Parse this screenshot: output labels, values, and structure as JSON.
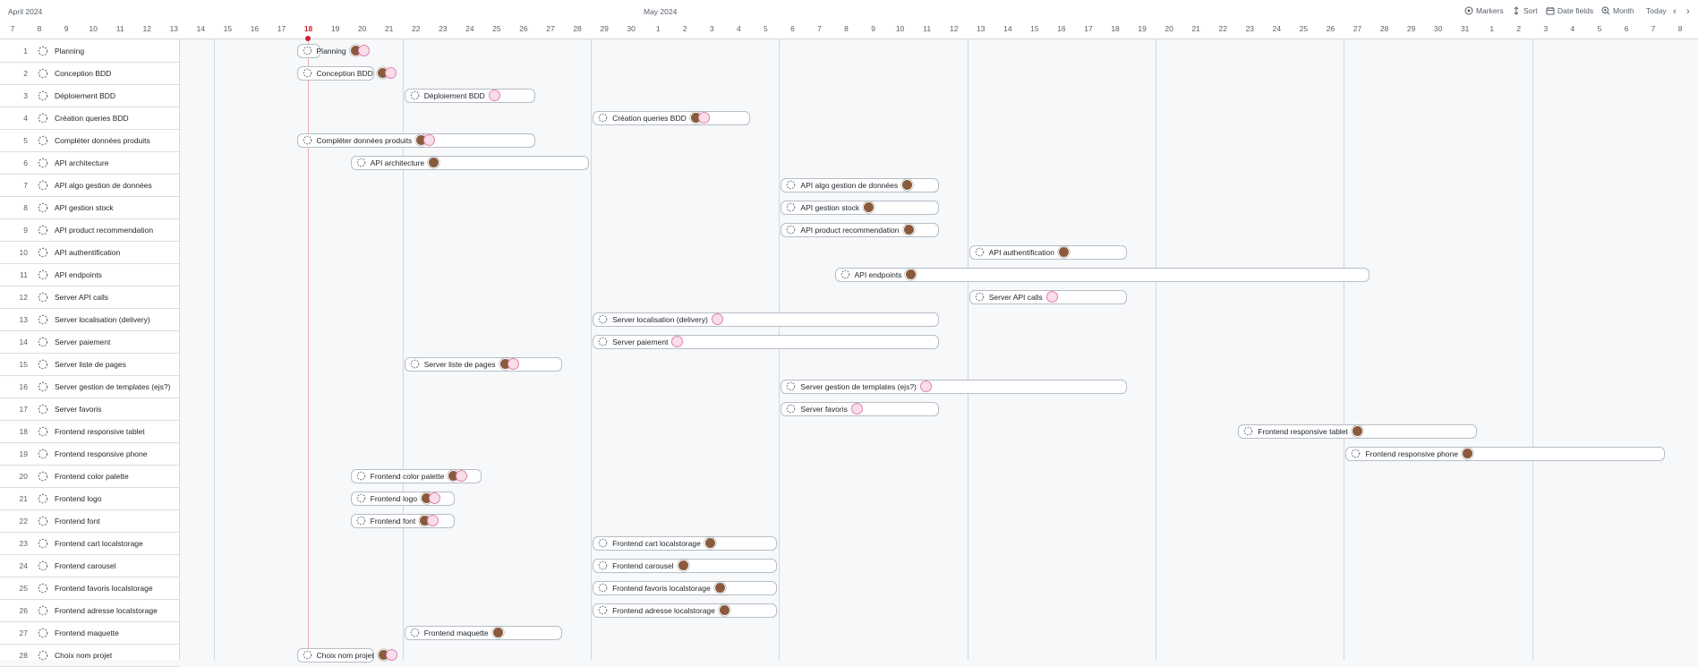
{
  "header": {
    "month_april": "April 2024",
    "month_may": "May 2024",
    "days": [
      "7",
      "8",
      "9",
      "10",
      "11",
      "12",
      "13",
      "14",
      "15",
      "16",
      "17",
      "18",
      "19",
      "20",
      "21",
      "22",
      "23",
      "24",
      "25",
      "26",
      "27",
      "28",
      "29",
      "30",
      "1",
      "2",
      "3",
      "4",
      "5",
      "6",
      "7",
      "8",
      "9",
      "10",
      "11",
      "12",
      "13",
      "14",
      "15",
      "16",
      "17",
      "18",
      "19",
      "20",
      "21",
      "22",
      "23",
      "24",
      "25",
      "26",
      "27",
      "28",
      "29",
      "30",
      "31",
      "1",
      "2",
      "3",
      "4",
      "5",
      "6",
      "7",
      "8"
    ],
    "today_day": "18",
    "toolbar": {
      "markers": "Markers",
      "sort": "Sort",
      "date_fields": "Date fields",
      "month": "Month",
      "today": "Today"
    }
  },
  "rows": [
    {
      "num": "1",
      "title": "Planning",
      "bar": {
        "label": "Planning",
        "start": 11,
        "end": 11,
        "avatar": "both"
      }
    },
    {
      "num": "2",
      "title": "Conception BDD",
      "bar": {
        "label": "Conception BDD",
        "start": 11,
        "end": 13,
        "avatar": "both"
      }
    },
    {
      "num": "3",
      "title": "Déploiement BDD",
      "bar": {
        "label": "Déploiement BDD",
        "start": 15,
        "end": 19,
        "avatar": "pink"
      }
    },
    {
      "num": "4",
      "title": "Création queries BDD",
      "bar": {
        "label": "Création queries BDD",
        "start": 22,
        "end": 27,
        "avatar": "both"
      }
    },
    {
      "num": "5",
      "title": "Compléter données produits",
      "bar": {
        "label": "Compléter données produits",
        "start": 11,
        "end": 19,
        "avatar": "both"
      }
    },
    {
      "num": "6",
      "title": "API architecture",
      "bar": {
        "label": "API architecture",
        "start": 13,
        "end": 21,
        "avatar": "brown"
      }
    },
    {
      "num": "7",
      "title": "API algo gestion de données",
      "bar": {
        "label": "API algo gestion de données",
        "start": 29,
        "end": 34,
        "avatar": "brown"
      }
    },
    {
      "num": "8",
      "title": "API gestion stock",
      "bar": {
        "label": "API gestion stock",
        "start": 29,
        "end": 34,
        "avatar": "brown"
      }
    },
    {
      "num": "9",
      "title": "API product recommendation",
      "bar": {
        "label": "API product recommendation",
        "start": 29,
        "end": 34,
        "avatar": "brown"
      }
    },
    {
      "num": "10",
      "title": "API authentification",
      "bar": {
        "label": "API authentification",
        "start": 36,
        "end": 41,
        "avatar": "brown"
      }
    },
    {
      "num": "11",
      "title": "API endpoints",
      "bar": {
        "label": "API endpoints",
        "start": 31,
        "end": 50,
        "avatar": "brown"
      }
    },
    {
      "num": "12",
      "title": "Server API calls",
      "bar": {
        "label": "Server API calls",
        "start": 36,
        "end": 41,
        "avatar": "pink"
      }
    },
    {
      "num": "13",
      "title": "Server localisation (delivery)",
      "bar": {
        "label": "Server localisation (delivery)",
        "start": 22,
        "end": 34,
        "avatar": "pink"
      }
    },
    {
      "num": "14",
      "title": "Server paiement",
      "bar": {
        "label": "Server paiement",
        "start": 22,
        "end": 34,
        "avatar": "pink"
      }
    },
    {
      "num": "15",
      "title": "Server liste de pages",
      "bar": {
        "label": "Server liste de pages",
        "start": 15,
        "end": 20,
        "avatar": "both"
      }
    },
    {
      "num": "16",
      "title": "Server gestion de templates (ejs?)",
      "bar": {
        "label": "Server gestion de templates (ejs?)",
        "start": 29,
        "end": 41,
        "avatar": "pink"
      }
    },
    {
      "num": "17",
      "title": "Server favoris",
      "bar": {
        "label": "Server favoris",
        "start": 29,
        "end": 34,
        "avatar": "pink"
      }
    },
    {
      "num": "18",
      "title": "Frontend responsive tablet",
      "bar": {
        "label": "Frontend responsive tablet",
        "start": 46,
        "end": 54,
        "avatar": "brown"
      }
    },
    {
      "num": "19",
      "title": "Frontend responsive phone",
      "bar": {
        "label": "Frontend responsive phone",
        "start": 50,
        "end": 61,
        "avatar": "brown"
      }
    },
    {
      "num": "20",
      "title": "Frontend color palette",
      "bar": {
        "label": "Frontend color palette",
        "start": 13,
        "end": 17,
        "avatar": "both"
      }
    },
    {
      "num": "21",
      "title": "Frontend logo",
      "bar": {
        "label": "Frontend logo",
        "start": 13,
        "end": 16,
        "avatar": "both"
      }
    },
    {
      "num": "22",
      "title": "Frontend font",
      "bar": {
        "label": "Frontend font",
        "start": 13,
        "end": 16,
        "avatar": "both"
      }
    },
    {
      "num": "23",
      "title": "Frontend cart localstorage",
      "bar": {
        "label": "Frontend cart localstorage",
        "start": 22,
        "end": 28,
        "avatar": "brown"
      }
    },
    {
      "num": "24",
      "title": "Frontend carousel",
      "bar": {
        "label": "Frontend carousel",
        "start": 22,
        "end": 28,
        "avatar": "brown"
      }
    },
    {
      "num": "25",
      "title": "Frontend favoris localstorage",
      "bar": {
        "label": "Frontend favoris localstorage",
        "start": 22,
        "end": 28,
        "avatar": "brown"
      }
    },
    {
      "num": "26",
      "title": "Frontend adresse localstorage",
      "bar": {
        "label": "Frontend adresse localstorage",
        "start": 22,
        "end": 28,
        "avatar": "brown"
      }
    },
    {
      "num": "27",
      "title": "Frontend maquette",
      "bar": {
        "label": "Frontend maquette",
        "start": 15,
        "end": 20,
        "avatar": "brown"
      }
    },
    {
      "num": "28",
      "title": "Choix nom projet",
      "bar": {
        "label": "Choix nom projet",
        "start": 11,
        "end": 13,
        "avatar": "both"
      }
    }
  ],
  "colors": {
    "today": "#cf222e",
    "bar_border": "#b6bec7",
    "avatar_brown": "#8a5a3c",
    "avatar_pink": "#e082b0"
  }
}
